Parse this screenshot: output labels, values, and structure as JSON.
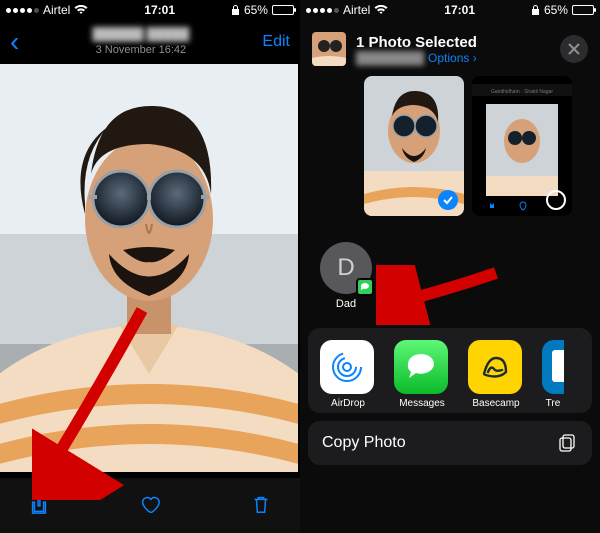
{
  "status": {
    "carrier": "Airtel",
    "wifi_icon": "wifi",
    "time": "17:01",
    "lock_icon": "lock",
    "battery_pct": "65%",
    "battery_fill": 65
  },
  "left_phone": {
    "nav": {
      "back": "‹",
      "title_redacted": "██████ █████",
      "subtitle": "3 November  16:42",
      "edit_label": "Edit"
    },
    "toolbar": {
      "share_icon": "share-icon",
      "heart_icon": "heart-icon",
      "trash_icon": "trash-icon"
    },
    "photo": {
      "alt": "selfie of a man with round sunglasses and a striped shirt in a car"
    }
  },
  "right_phone": {
    "share_sheet": {
      "title": "1 Photo Selected",
      "subtitle_redacted": "████████",
      "options_label": "Options",
      "thumbnails": [
        {
          "selected": true
        },
        {
          "selected": false,
          "overlay_label": "Gandhidham · Shakti Nagar"
        }
      ],
      "contacts": [
        {
          "initial": "D",
          "name": "Dad",
          "badge_app": "messages"
        }
      ],
      "apps": [
        {
          "id": "airdrop",
          "label": "AirDrop"
        },
        {
          "id": "messages",
          "label": "Messages"
        },
        {
          "id": "basecamp",
          "label": "Basecamp"
        },
        {
          "id": "trello",
          "label": "Tre"
        }
      ],
      "actions": [
        {
          "label": "Copy Photo",
          "icon": "copy-icon"
        }
      ]
    }
  },
  "annotations": {
    "arrow_left_target": "share-button",
    "arrow_right_target": "contact-dad"
  }
}
